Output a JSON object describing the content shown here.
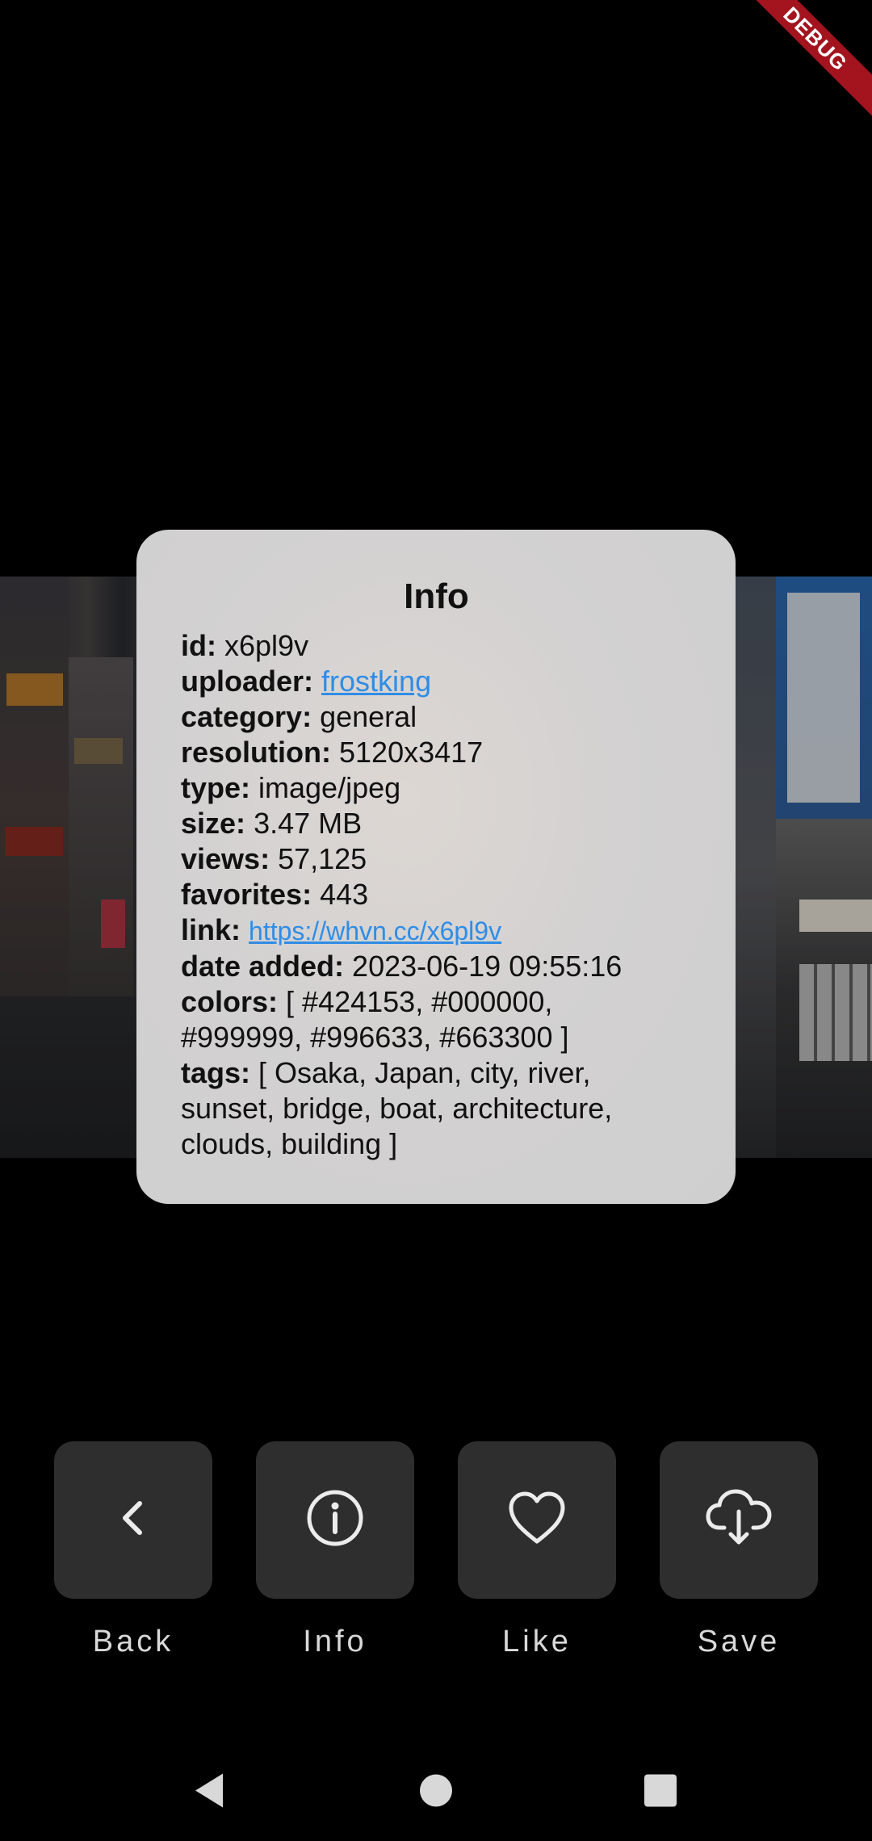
{
  "debug_banner": "DEBUG",
  "dialog": {
    "title": "Info",
    "fields": {
      "id": {
        "key": "id:",
        "value": "x6pl9v"
      },
      "uploader": {
        "key": "uploader:",
        "value": "frostking"
      },
      "category": {
        "key": "category:",
        "value": "general"
      },
      "resolution": {
        "key": "resolution:",
        "value": "5120x3417"
      },
      "type": {
        "key": "type:",
        "value": "image/jpeg"
      },
      "size": {
        "key": "size:",
        "value": "3.47 MB"
      },
      "views": {
        "key": "views:",
        "value": "57,125"
      },
      "favorites": {
        "key": "favorites:",
        "value": "443"
      },
      "link": {
        "key": "link:",
        "value": "https://whvn.cc/x6pl9v"
      },
      "date_added": {
        "key": "date added:",
        "value": "2023-06-19 09:55:16"
      },
      "colors": {
        "key": "colors:",
        "line1": "[ #424153, #000000,",
        "line2": "#999999, #996633, #663300 ]"
      },
      "tags": {
        "key": "tags:",
        "line1": "[ Osaka, Japan, city, river,",
        "line2": "sunset, bridge, boat, architecture,",
        "line3": "clouds, building ]"
      }
    }
  },
  "actions": [
    {
      "label": "Back",
      "icon": "chevron-left-icon"
    },
    {
      "label": "Info",
      "icon": "info-circle-icon"
    },
    {
      "label": "Like",
      "icon": "heart-outline-icon"
    },
    {
      "label": "Save",
      "icon": "cloud-download-icon"
    }
  ],
  "colors": {
    "link": "#2f8de6",
    "tile": "#2e2e2e",
    "debug": "#a3141e"
  }
}
